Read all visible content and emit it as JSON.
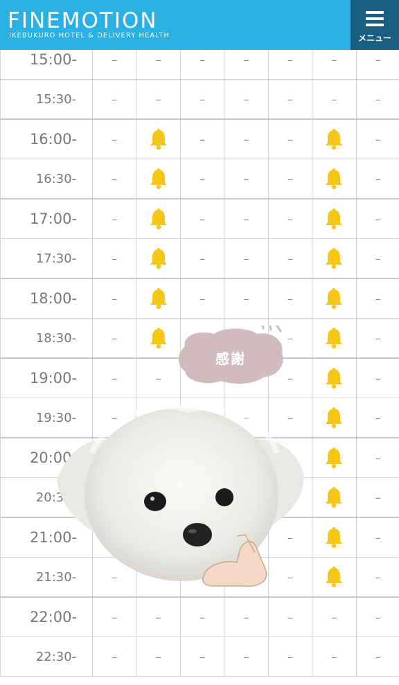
{
  "header": {
    "logo_title": "FINEMOTION",
    "logo_subtitle": "IKEBUKURO HOTEL & DELIVERY HEALTH",
    "menu_label": "メニュー",
    "color": "#2ab0e2",
    "menu_color": "#1a5d82"
  },
  "schedule": {
    "empty_mark": "–",
    "available_icon": "bell-icon",
    "bell_color": "#f5c518",
    "rows": [
      {
        "time": "15:00-",
        "slots": [
          "-",
          "-",
          "-",
          "-",
          "-",
          "-",
          "-"
        ]
      },
      {
        "time": "15:30-",
        "slots": [
          "-",
          "-",
          "-",
          "-",
          "-",
          "-",
          "-"
        ]
      },
      {
        "time": "16:00-",
        "slots": [
          "-",
          "bell",
          "-",
          "-",
          "-",
          "bell",
          "-"
        ]
      },
      {
        "time": "16:30-",
        "slots": [
          "-",
          "bell",
          "-",
          "-",
          "-",
          "bell",
          "-"
        ]
      },
      {
        "time": "17:00-",
        "slots": [
          "-",
          "bell",
          "-",
          "-",
          "-",
          "bell",
          "-"
        ]
      },
      {
        "time": "17:30-",
        "slots": [
          "-",
          "bell",
          "-",
          "-",
          "-",
          "bell",
          "-"
        ]
      },
      {
        "time": "18:00-",
        "slots": [
          "-",
          "bell",
          "-",
          "-",
          "-",
          "bell",
          "-"
        ]
      },
      {
        "time": "18:30-",
        "slots": [
          "-",
          "bell",
          "-",
          "-",
          "-",
          "bell",
          "-"
        ]
      },
      {
        "time": "19:00-",
        "slots": [
          "-",
          "-",
          "-",
          "-",
          "-",
          "bell",
          "-"
        ]
      },
      {
        "time": "19:30-",
        "slots": [
          "-",
          "-",
          "-",
          "-",
          "-",
          "bell",
          "-"
        ]
      },
      {
        "time": "20:00-",
        "slots": [
          "-",
          "-",
          "-",
          "-",
          "-",
          "bell",
          "-"
        ]
      },
      {
        "time": "20:30-",
        "slots": [
          "-",
          "-",
          "-",
          "-",
          "-",
          "bell",
          "-"
        ]
      },
      {
        "time": "21:00-",
        "slots": [
          "-",
          "-",
          "-",
          "-",
          "-",
          "bell",
          "-"
        ]
      },
      {
        "time": "21:30-",
        "slots": [
          "-",
          "-",
          "-",
          "-",
          "-",
          "bell",
          "-"
        ]
      },
      {
        "time": "22:00-",
        "slots": [
          "-",
          "-",
          "-",
          "-",
          "-",
          "-",
          "-"
        ]
      },
      {
        "time": "22:30-",
        "slots": [
          "-",
          "-",
          "-",
          "-",
          "-",
          "-",
          "-"
        ]
      }
    ]
  },
  "stickers": {
    "bubble_text": "感謝",
    "bubble_color": "#cdb8bc"
  }
}
